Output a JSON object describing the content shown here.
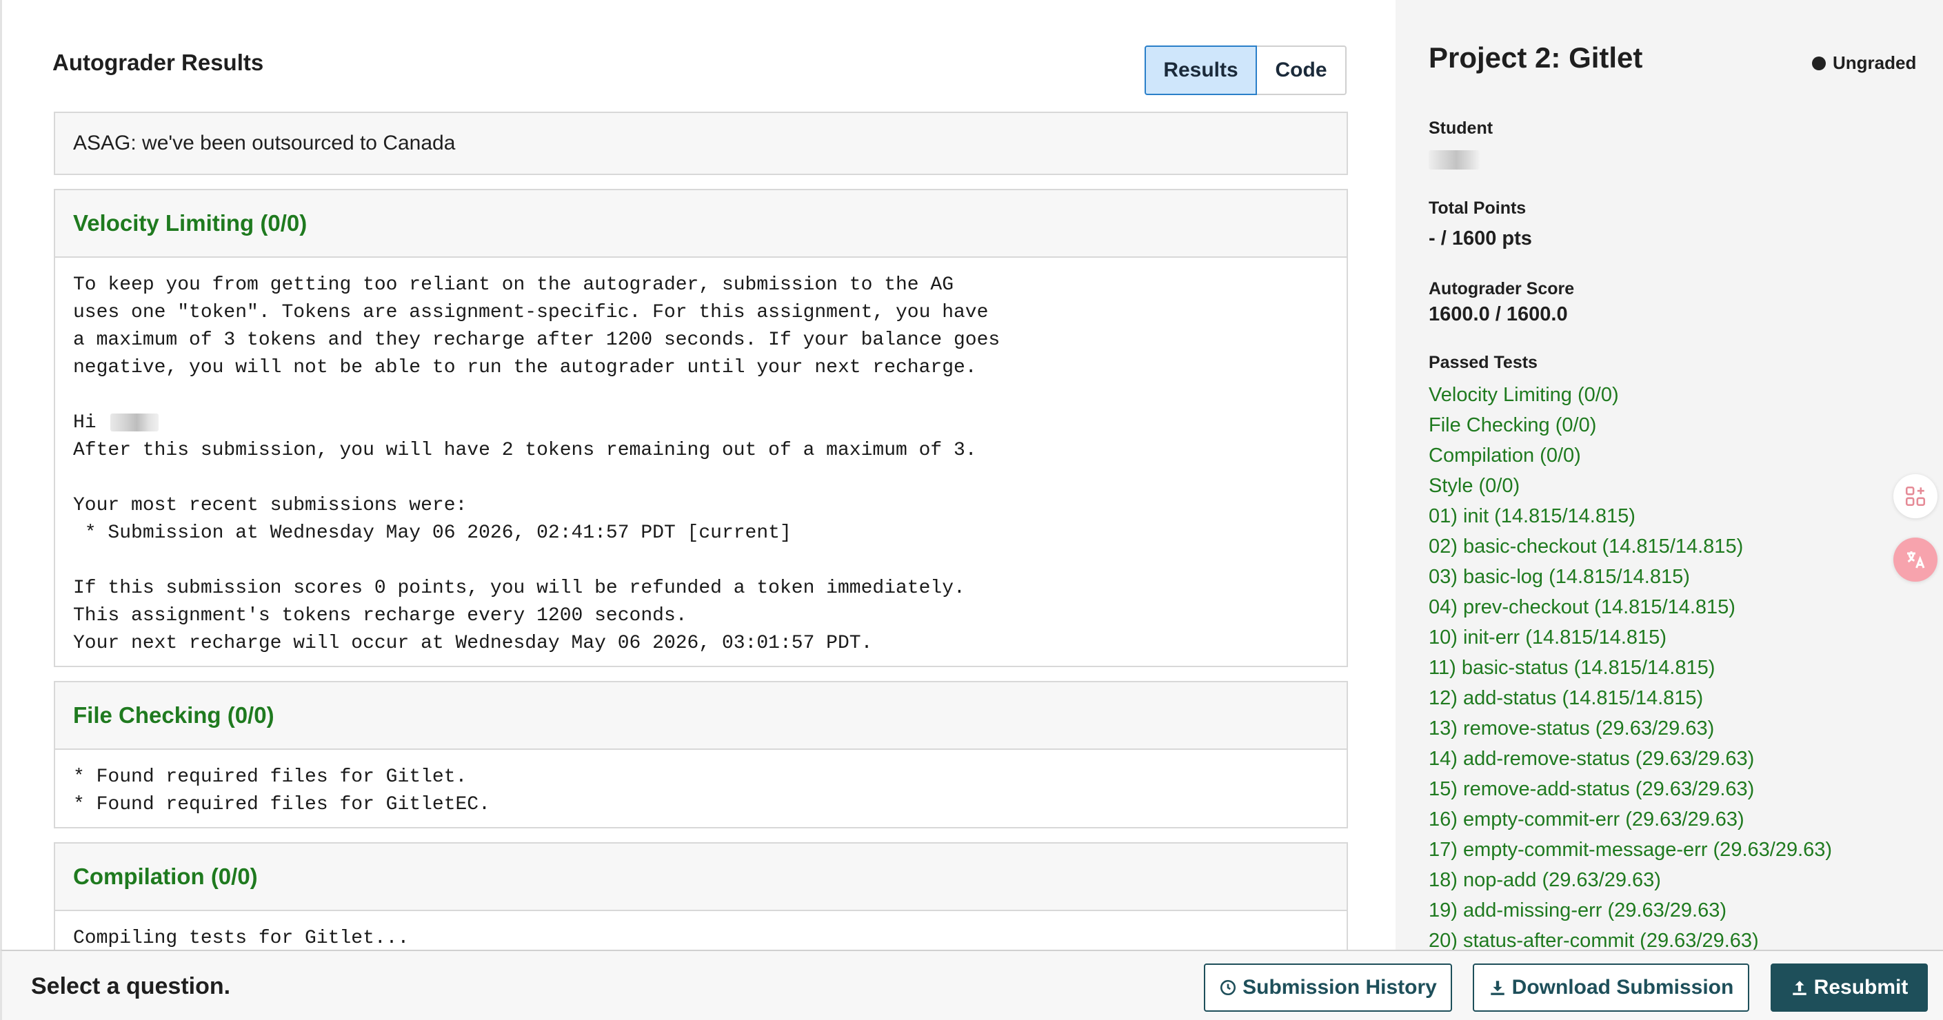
{
  "main": {
    "title": "Autograder Results",
    "tabs": [
      {
        "label": "Results",
        "active": true
      },
      {
        "label": "Code",
        "active": false
      }
    ],
    "banner": "ASAG: we've been outsourced to Canada",
    "sections": {
      "velocity": {
        "title": "Velocity Limiting (0/0)",
        "body_before_name": "To keep you from getting too reliant on the autograder, submission to the AG\nuses one \"token\". Tokens are assignment-specific. For this assignment, you have\na maximum of 3 tokens and they recharge after 1200 seconds. If your balance goes\nnegative, you will not be able to run the autograder until your next recharge.\n\nHi ",
        "body_after_name": "\nAfter this submission, you will have 2 tokens remaining out of a maximum of 3.\n\nYour most recent submissions were:\n * Submission at Wednesday May 06 2026, 02:41:57 PDT [current]\n\nIf this submission scores 0 points, you will be refunded a token immediately.\nThis assignment's tokens recharge every 1200 seconds.\nYour next recharge will occur at Wednesday May 06 2026, 03:01:57 PDT."
      },
      "files": {
        "title": "File Checking (0/0)",
        "body": "* Found required files for Gitlet.\n* Found required files for GitletEC."
      },
      "compile": {
        "title": "Compilation (0/0)",
        "body": "Compiling tests for Gitlet..."
      }
    }
  },
  "sidebar": {
    "project_title": "Project 2: Gitlet",
    "status": "Ungraded",
    "student_label": "Student",
    "total_points_label": "Total Points",
    "total_points_value": "- / 1600 pts",
    "autograder_score_label": "Autograder Score",
    "autograder_score_value": "1600.0 / 1600.0",
    "passed_tests_label": "Passed Tests",
    "passed_tests": [
      "Velocity Limiting (0/0)",
      "File Checking (0/0)",
      "Compilation (0/0)",
      "Style (0/0)",
      "01) init (14.815/14.815)",
      "02) basic-checkout (14.815/14.815)",
      "03) basic-log (14.815/14.815)",
      "04) prev-checkout (14.815/14.815)",
      "10) init-err (14.815/14.815)",
      "11) basic-status (14.815/14.815)",
      "12) add-status (14.815/14.815)",
      "13) remove-status (29.63/29.63)",
      "14) add-remove-status (29.63/29.63)",
      "15) remove-add-status (29.63/29.63)",
      "16) empty-commit-err (29.63/29.63)",
      "17) empty-commit-message-err (29.63/29.63)",
      "18) nop-add (29.63/29.63)",
      "19) add-missing-err (29.63/29.63)",
      "20) status-after-commit (29.63/29.63)"
    ]
  },
  "footer": {
    "prompt": "Select a question.",
    "submission_history": "Submission History",
    "download_submission": "Download Submission",
    "resubmit": "Resubmit"
  },
  "colors": {
    "accent_green": "#1f7a1f",
    "primary_teal": "#1e4f5a",
    "active_tab_bg": "#cfe6fb",
    "active_tab_border": "#2a7fc9"
  },
  "icons": [
    "clock-icon",
    "download-icon",
    "upload-icon",
    "apps-icon",
    "translate-icon"
  ]
}
